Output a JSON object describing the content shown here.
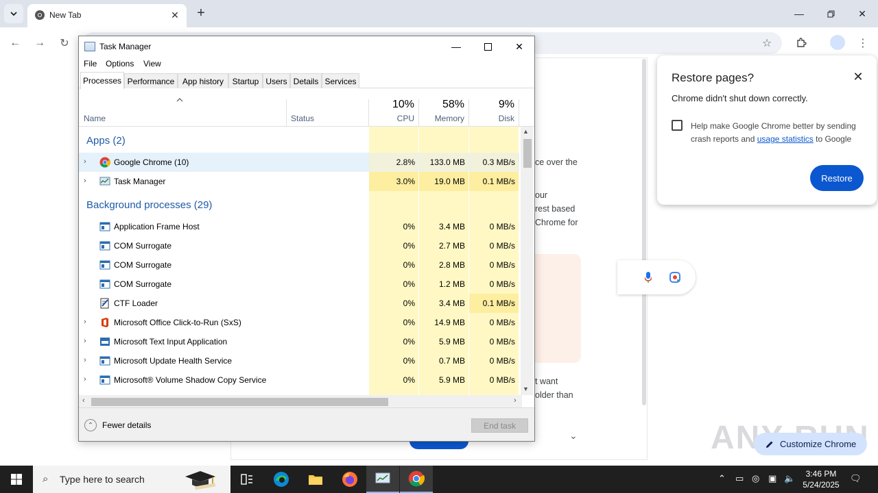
{
  "browser": {
    "tab_title": "New Tab",
    "restore_bubble": {
      "title": "Restore pages?",
      "message": "Chrome didn't shut down correctly.",
      "checkbox_text": "Help make Google Chrome better by sending crash reports and",
      "checkbox_link": "usage statistics",
      "checkbox_suffix": "to Google",
      "restore_label": "Restore"
    },
    "customize_label": "Customize Chrome",
    "watermark": "ANY RUN",
    "ntp_fragments": [
      "ce over the",
      "our",
      "rest based",
      "Chrome for",
      "t want",
      "older than"
    ]
  },
  "task_manager": {
    "title": "Task Manager",
    "menu": [
      "File",
      "Options",
      "View"
    ],
    "tabs": [
      "Processes",
      "Performance",
      "App history",
      "Startup",
      "Users",
      "Details",
      "Services"
    ],
    "active_tab": "Processes",
    "columns": {
      "name": "Name",
      "status": "Status",
      "cpu_pct": "10%",
      "cpu": "CPU",
      "mem_pct": "58%",
      "mem": "Memory",
      "disk_pct": "9%",
      "disk": "Disk"
    },
    "groups": {
      "apps": "Apps (2)",
      "background": "Background processes (29)"
    },
    "apps": [
      {
        "name": "Google Chrome (10)",
        "cpu": "2.8%",
        "mem": "133.0 MB",
        "disk": "0.3 MB/s",
        "icon": "chrome-icon"
      },
      {
        "name": "Task Manager",
        "cpu": "3.0%",
        "mem": "19.0 MB",
        "disk": "0.1 MB/s",
        "icon": "task-manager-icon"
      }
    ],
    "background": [
      {
        "name": "Application Frame Host",
        "cpu": "0%",
        "mem": "3.4 MB",
        "disk": "0 MB/s",
        "expand": false
      },
      {
        "name": "COM Surrogate",
        "cpu": "0%",
        "mem": "2.7 MB",
        "disk": "0 MB/s",
        "expand": false
      },
      {
        "name": "COM Surrogate",
        "cpu": "0%",
        "mem": "2.8 MB",
        "disk": "0 MB/s",
        "expand": false
      },
      {
        "name": "COM Surrogate",
        "cpu": "0%",
        "mem": "1.2 MB",
        "disk": "0 MB/s",
        "expand": false
      },
      {
        "name": "CTF Loader",
        "cpu": "0%",
        "mem": "3.4 MB",
        "disk": "0.1 MB/s",
        "expand": false
      },
      {
        "name": "Microsoft Office Click-to-Run (SxS)",
        "cpu": "0%",
        "mem": "14.9 MB",
        "disk": "0 MB/s",
        "expand": true
      },
      {
        "name": "Microsoft Text Input Application",
        "cpu": "0%",
        "mem": "5.9 MB",
        "disk": "0 MB/s",
        "expand": true
      },
      {
        "name": "Microsoft Update Health Service",
        "cpu": "0%",
        "mem": "0.7 MB",
        "disk": "0 MB/s",
        "expand": true
      },
      {
        "name": "Microsoft® Volume Shadow Copy Service",
        "cpu": "0%",
        "mem": "5.9 MB",
        "disk": "0 MB/s",
        "expand": true
      }
    ],
    "fewer_details": "Fewer details",
    "end_task": "End task"
  },
  "taskbar": {
    "search_placeholder": "Type here to search",
    "time": "3:46 PM",
    "date": "5/24/2025"
  }
}
